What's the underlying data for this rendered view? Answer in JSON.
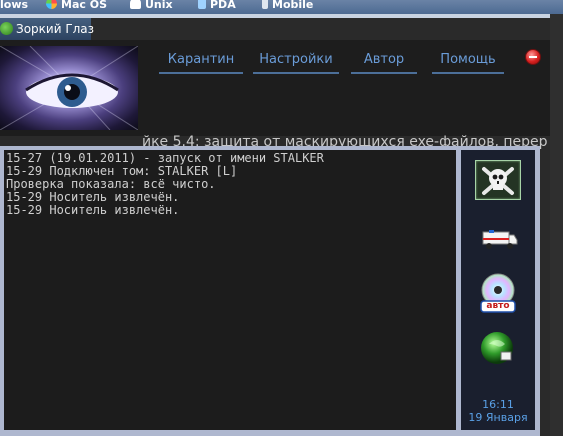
{
  "os_tabs": [
    {
      "label": "lows",
      "icon": "windows-icon"
    },
    {
      "label": "Mac OS",
      "icon": "apple-icon"
    },
    {
      "label": "Unix",
      "icon": "tux-icon"
    },
    {
      "label": "PDA",
      "icon": "pda-icon"
    },
    {
      "label": "Mobile",
      "icon": "mobile-icon"
    }
  ],
  "window": {
    "title": "Зоркий Глаз",
    "title_icon": "app-icon"
  },
  "menu": {
    "items": [
      "Карантин",
      "Настройки",
      "Автор",
      "Помощь"
    ]
  },
  "close_icon": "close-icon",
  "ticker": "йке 5.4: защита от маскирующихся exe-файлов, перер",
  "log": {
    "lines": [
      "15-27 (19.01.2011) - запуск от имени STALKER",
      "15-29 Подключен том: STALKER [L]",
      "Проверка показала: всё чисто.",
      "15-29 Носитель извлечён.",
      "15-29 Носитель извлечён."
    ]
  },
  "side": {
    "buttons": [
      {
        "name": "skull-icon"
      },
      {
        "name": "ambulance-icon"
      },
      {
        "name": "cd-auto-icon",
        "badge": "авто"
      },
      {
        "name": "green-globe-icon"
      }
    ],
    "time": "16:11",
    "date": "19 Января"
  },
  "colors": {
    "accent": "#6a9cd8",
    "panel_border": "#aeb7cf",
    "background": "#1f1f1f"
  }
}
